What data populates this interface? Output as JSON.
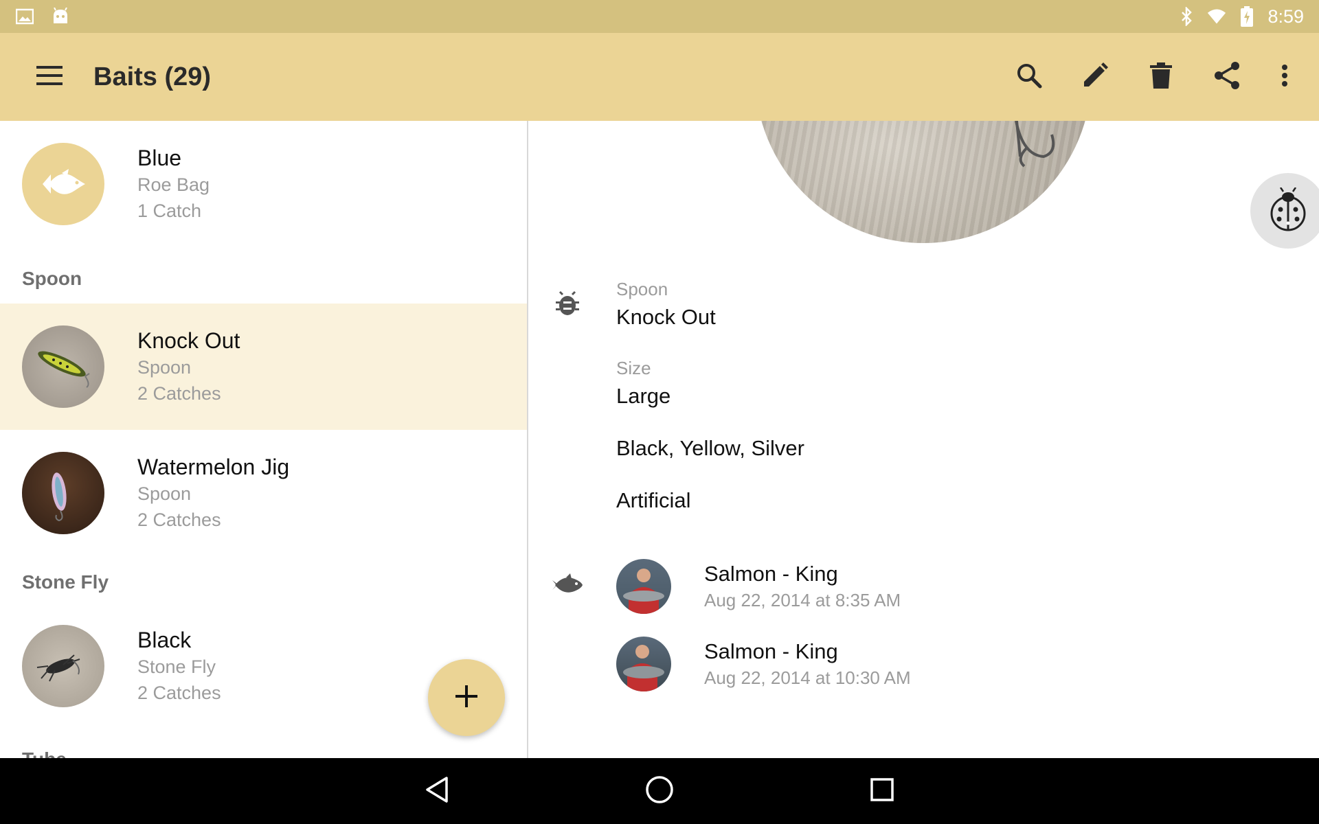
{
  "status_bar": {
    "time": "8:59",
    "left_icons": [
      "image-icon",
      "android-icon"
    ],
    "right_icons": [
      "bluetooth-icon",
      "wifi-icon",
      "battery-icon"
    ]
  },
  "toolbar": {
    "title": "Baits (29)",
    "menu_icon": "menu-icon",
    "actions": [
      "search-icon",
      "edit-icon",
      "delete-icon",
      "share-icon",
      "more-vert-icon"
    ],
    "background": "#ebd495"
  },
  "list": {
    "items": [
      {
        "title": "Blue",
        "type": "Roe Bag",
        "catches": "1 Catch"
      },
      {
        "section": "Spoon"
      },
      {
        "title": "Knock Out",
        "type": "Spoon",
        "catches": "2 Catches",
        "selected": true
      },
      {
        "title": "Watermelon Jig",
        "type": "Spoon",
        "catches": "2 Catches"
      },
      {
        "section": "Stone Fly"
      },
      {
        "title": "Black",
        "type": "Stone Fly",
        "catches": "2 Catches"
      },
      {
        "section": "Tube"
      }
    ],
    "fab_icon": "add-icon"
  },
  "detail": {
    "category_label": "Spoon",
    "name": "Knock Out",
    "size_label": "Size",
    "size_value": "Large",
    "colors": "Black, Yellow, Silver",
    "bait_type": "Artificial",
    "catches": [
      {
        "species": "Salmon - King",
        "date": "Aug 22, 2014 at 8:35 AM"
      },
      {
        "species": "Salmon - King",
        "date": "Aug 22, 2014 at 10:30 AM"
      }
    ],
    "debug_icon": "ladybug-icon"
  },
  "nav_bar": {
    "buttons": [
      "back-icon",
      "home-icon",
      "recents-icon"
    ]
  }
}
